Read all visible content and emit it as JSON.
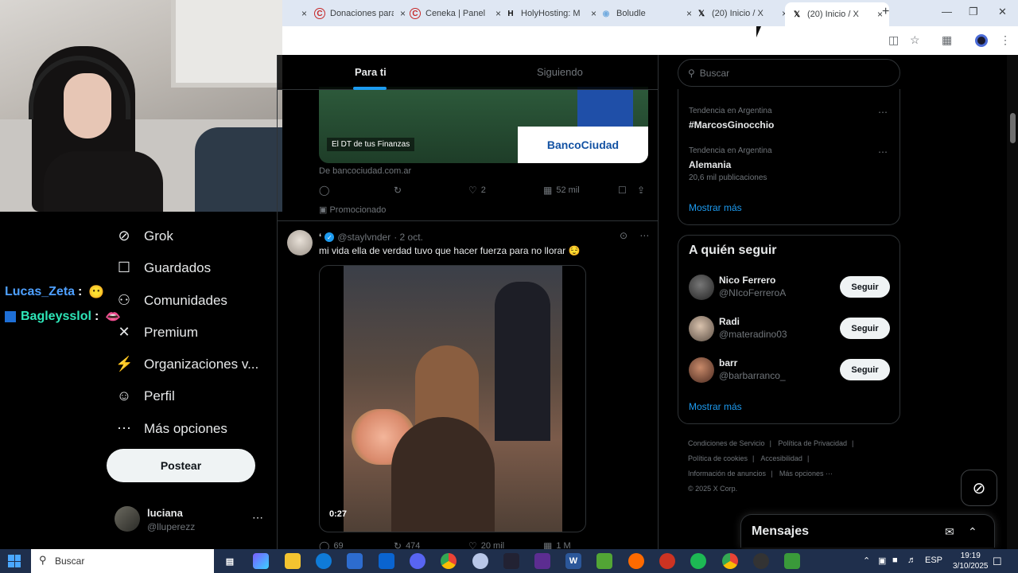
{
  "browser": {
    "tabs": [
      {
        "title": "Donaciones para",
        "favicon": "C",
        "favicon_color": "#c62828"
      },
      {
        "title": "Ceneka | Panel",
        "favicon": "C",
        "favicon_color": "#c62828"
      },
      {
        "title": "HolyHosting: M",
        "favicon": "H",
        "favicon_color": "#111111"
      },
      {
        "title": "Boludle",
        "favicon": "◉",
        "favicon_color": "#74acdf"
      },
      {
        "title": "(20) Inicio / X",
        "favicon": "𝕏",
        "favicon_color": "#000000"
      },
      {
        "title": "(20) Inicio / X",
        "favicon": "𝕏",
        "favicon_color": "#000000"
      }
    ],
    "new_tab": "+",
    "close": "×"
  },
  "stream_chat": [
    {
      "user": "Lucas_Zeta",
      "sep": ":",
      "emoji": "😶",
      "color": "#4ea0ff"
    },
    {
      "user": "Bagleysslol",
      "sep": ":",
      "emoji": "👄",
      "color": "#2ee6b8"
    }
  ],
  "nav": {
    "items": [
      {
        "label": "Grok",
        "icon": "grok-icon",
        "glyph": "⊘"
      },
      {
        "label": "Guardados",
        "icon": "bookmark-icon",
        "glyph": "☐"
      },
      {
        "label": "Comunidades",
        "icon": "communities-icon",
        "glyph": "⚇"
      },
      {
        "label": "Premium",
        "icon": "x-logo-icon",
        "glyph": "✕"
      },
      {
        "label": "Organizaciones v...",
        "icon": "lightning-icon",
        "glyph": "⚡"
      },
      {
        "label": "Perfil",
        "icon": "profile-icon",
        "glyph": "☺"
      },
      {
        "label": "Más opciones",
        "icon": "more-options-icon",
        "glyph": "⋯"
      }
    ],
    "post_label": "Postear",
    "account": {
      "name": "luciana",
      "handle": "@lluperezz",
      "more": "⋯"
    }
  },
  "feed": {
    "tabs": [
      "Para ti",
      "Siguiendo"
    ],
    "ad": {
      "overlay_text": "El DT de tus Finanzas",
      "brand": "BancoCiudad",
      "domain": "De bancociudad.com.ar",
      "likes": "2",
      "views": "52 mil",
      "promoted_label": "Promocionado"
    },
    "tweet": {
      "author_mark": "ʻ",
      "handle": "@staylvnder",
      "date": "· 2 oct.",
      "text": "mi vida ella de verdad tuvo que hacer fuerza para no llorar 😌",
      "video_time": "0:27",
      "replies": "69",
      "retweets": "474",
      "likes": "20 mil",
      "views": "1 M"
    }
  },
  "sidebar": {
    "search_placeholder": "Buscar",
    "trends": [
      {
        "context": "Tendencia en Argentina",
        "name": "#MarcosGinocchio",
        "count": ""
      },
      {
        "context": "Tendencia en Argentina",
        "name": "Alemania",
        "count": "20,6 mil publicaciones"
      }
    ],
    "trends_more": "Mostrar más",
    "who_to_follow_title": "A quién seguir",
    "follow": [
      {
        "name": "Nico Ferrero",
        "handle": "@NIcoFerreroA",
        "button": "Seguir"
      },
      {
        "name": "Radi",
        "handle": "@materadino03",
        "button": "Seguir"
      },
      {
        "name": "barr",
        "handle": "@barbarranco_",
        "button": "Seguir"
      }
    ],
    "follow_more": "Mostrar más",
    "footer": [
      "Condiciones de Servicio",
      "|",
      "Política de Privacidad",
      "|",
      "Política de cookies",
      "|",
      "Accesibilidad",
      "|",
      "Información de anuncios",
      "|",
      "Más opciones ···",
      "© 2025 X Corp."
    ],
    "messages_title": "Mensajes"
  },
  "taskbar": {
    "search_placeholder": "Buscar",
    "lang": "ESP",
    "time": "19:19",
    "date": "3/10/2025"
  }
}
